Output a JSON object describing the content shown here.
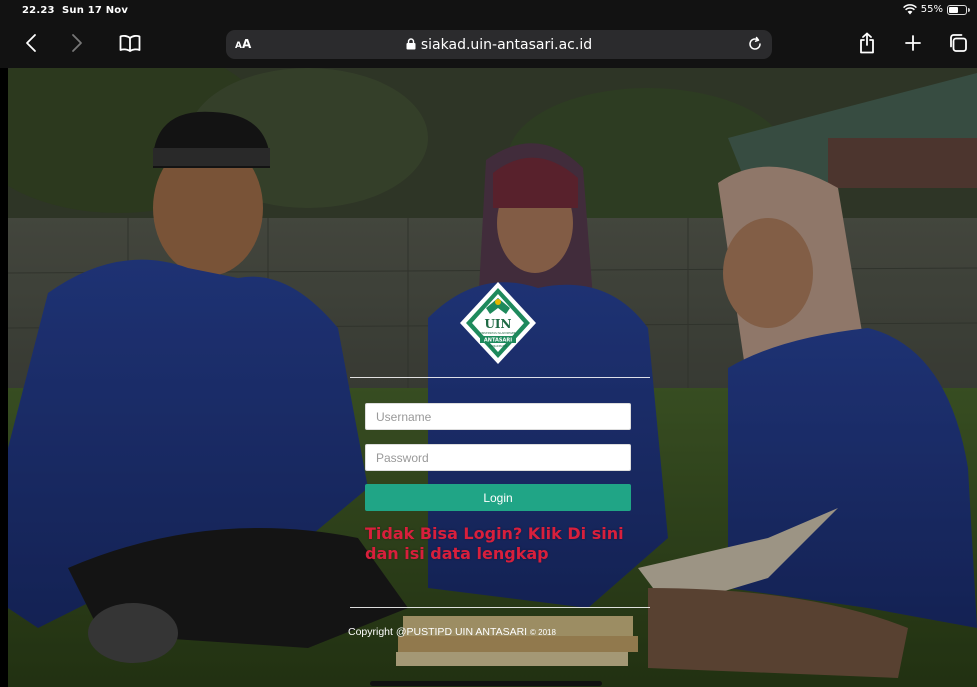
{
  "status_bar": {
    "time": "22.23",
    "date": "Sun 17 Nov",
    "battery": "55%",
    "battery_level": 0.55
  },
  "browser": {
    "reader_label_small": "A",
    "reader_label": "A",
    "url": "siakad.uin-antasari.ac.id",
    "icons": [
      "back-icon",
      "forward-icon",
      "bookmarks-icon",
      "lock-icon",
      "reload-icon",
      "share-icon",
      "new-tab-icon",
      "tabs-icon"
    ]
  },
  "logo": {
    "line1": "UIN",
    "line2": "UNIVERSITAS ISLAM NEGERI",
    "line3": "ANTASARI",
    "line4": "BANJARMASIN"
  },
  "login": {
    "username_placeholder": "Username",
    "password_placeholder": "Password",
    "button_label": "Login",
    "help_text": "Tidak Bisa Login? Klik Di sini dan isi data lengkap"
  },
  "footer": {
    "copyright": "Copyright @PUSTIPD UIN ANTASARI",
    "year": "© 2018"
  },
  "colors": {
    "login_button": "#20a586",
    "help_text": "#d81f3c",
    "logo_green": "#1e8a5c"
  }
}
